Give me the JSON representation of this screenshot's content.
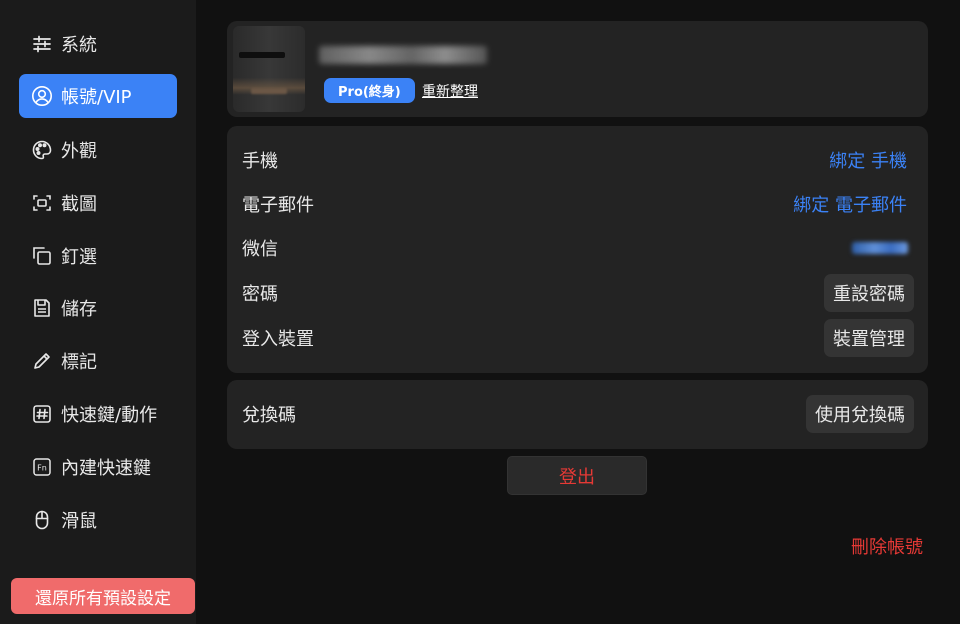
{
  "sidebar": {
    "items": [
      {
        "label": "系統",
        "icon": "sliders-icon",
        "active": false
      },
      {
        "label": "帳號/VIP",
        "icon": "user-circle-icon",
        "active": true
      },
      {
        "label": "外觀",
        "icon": "palette-icon",
        "active": false
      },
      {
        "label": "截圖",
        "icon": "screenshot-icon",
        "active": false
      },
      {
        "label": "釘選",
        "icon": "pin-copy-icon",
        "active": false
      },
      {
        "label": "儲存",
        "icon": "save-icon",
        "active": false
      },
      {
        "label": "標記",
        "icon": "pencil-icon",
        "active": false
      },
      {
        "label": "快速鍵/動作",
        "icon": "hash-key-icon",
        "active": false
      },
      {
        "label": "內建快速鍵",
        "icon": "fn-key-icon",
        "active": false
      },
      {
        "label": "滑鼠",
        "icon": "mouse-icon",
        "active": false
      }
    ],
    "reset_label": "還原所有預設設定"
  },
  "profile": {
    "badge": "Pro(終身)",
    "refresh_label": "重新整理"
  },
  "account": {
    "phone_label": "手機",
    "phone_action": "綁定 手機",
    "email_label": "電子郵件",
    "email_action": "綁定 電子郵件",
    "wechat_label": "微信",
    "password_label": "密碼",
    "password_action": "重設密碼",
    "devices_label": "登入裝置",
    "devices_action": "裝置管理"
  },
  "redeem": {
    "label": "兌換碼",
    "action": "使用兌換碼"
  },
  "logout_label": "登出",
  "delete_label": "刪除帳號",
  "colors": {
    "accent": "#3b82f6",
    "danger": "#e53935",
    "reset_button": "#f06b6b",
    "card": "#232323",
    "sidebar": "#1b1b1b",
    "background": "#111111"
  }
}
